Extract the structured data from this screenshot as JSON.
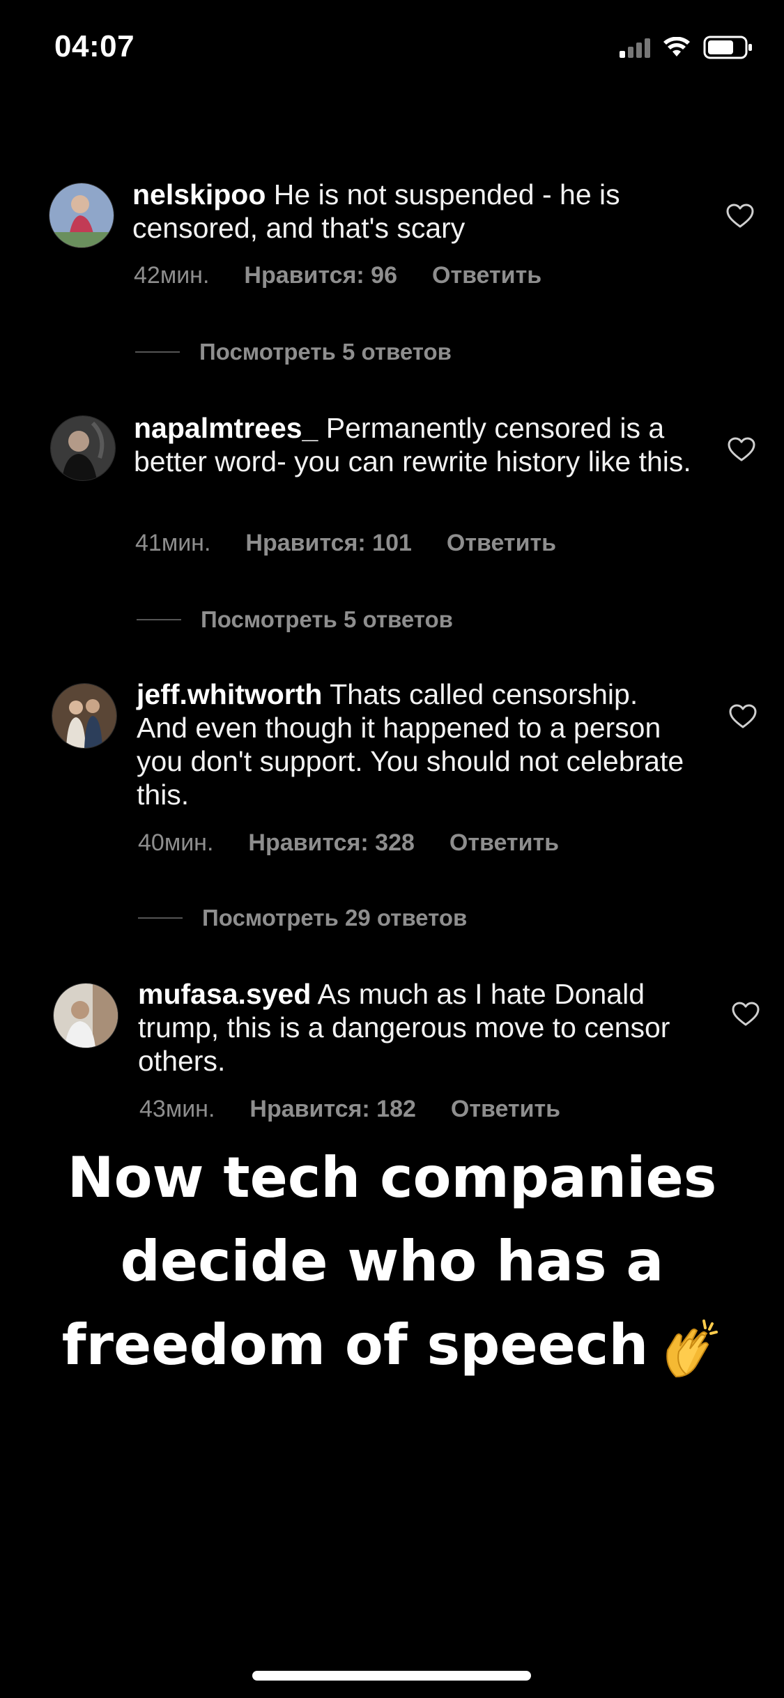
{
  "status_bar": {
    "time": "04:07"
  },
  "comments": [
    {
      "username": "nelskipoo",
      "text": "He is not suspended - he is censored, and that's scary",
      "time": "42мин.",
      "likes": "Нравится: 96",
      "reply": "Ответить",
      "view_replies": "Посмотреть 5 ответов"
    },
    {
      "username": "napalmtrees_",
      "text": "Permanently censored is a better word- you can rewrite history like this.",
      "time": "41мин.",
      "likes": "Нравится: 101",
      "reply": "Ответить",
      "view_replies": "Посмотреть 5 ответов"
    },
    {
      "username": "jeff.whitworth",
      "text": "Thats called censorship. And even though it happened to a person you don't support. You should not celebrate this.",
      "time": "40мин.",
      "likes": "Нравится: 328",
      "reply": "Ответить",
      "view_replies": "Посмотреть 29 ответов"
    },
    {
      "username": "mufasa.syed",
      "text": "As much as I hate Donald trump, this is a dangerous move to censor others.",
      "time": "43мин.",
      "likes": "Нравится: 182",
      "reply": "Ответить"
    }
  ],
  "caption": {
    "line1": "Now tech companies",
    "line2": "decide who has a",
    "line3": "freedom of speech"
  },
  "colors": {
    "background": "#000000",
    "meta_text": "#8e8e8e",
    "text": "#ffffff"
  },
  "icons": [
    "signal-icon",
    "wifi-icon",
    "battery-icon",
    "heart-icon",
    "clapping-hands-emoji"
  ]
}
